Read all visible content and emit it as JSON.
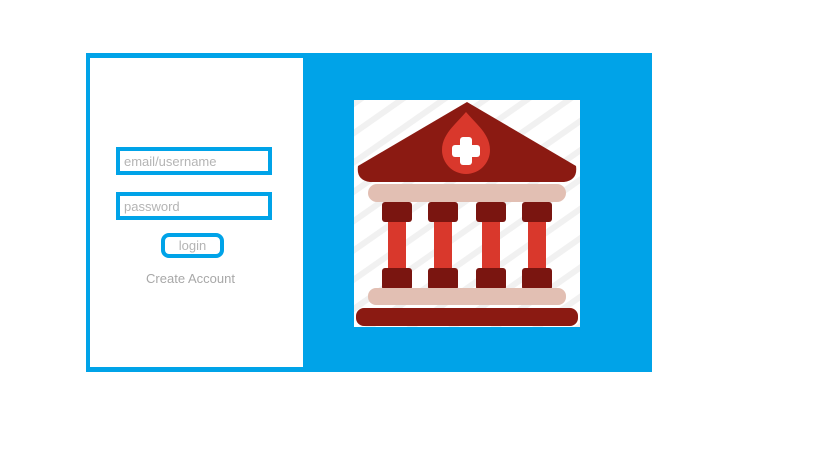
{
  "login_form": {
    "email_placeholder": "email/username",
    "password_placeholder": "password",
    "login_label": "login",
    "create_account_label": "Create Account"
  },
  "colors": {
    "frame": "#00a3e8",
    "logo_dark_red": "#8b1a12",
    "logo_red": "#d9382c",
    "logo_beige": "#e2bfb3"
  },
  "logo": {
    "icon": "bank-with-medical-cross-icon"
  }
}
